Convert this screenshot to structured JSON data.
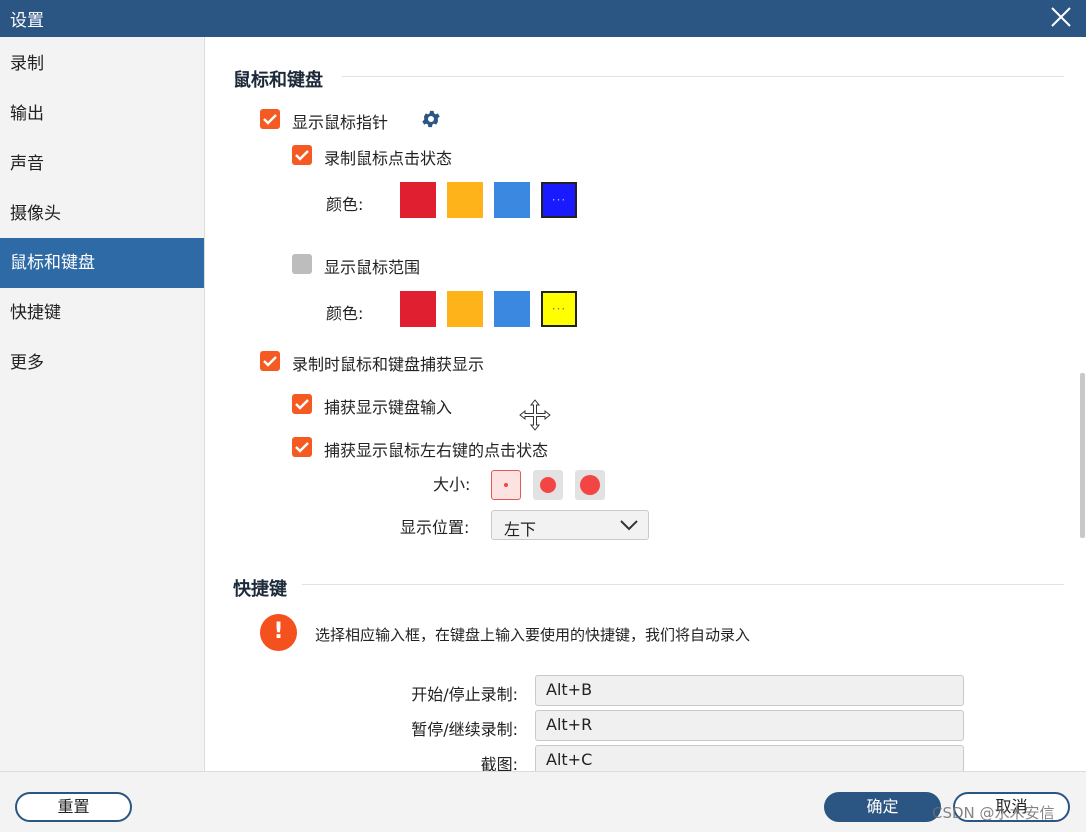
{
  "window": {
    "title": "设置"
  },
  "sidebar": {
    "items": [
      {
        "label": "录制"
      },
      {
        "label": "输出"
      },
      {
        "label": "声音"
      },
      {
        "label": "摄像头"
      },
      {
        "label": "鼠标和键盘",
        "active": true
      },
      {
        "label": "快捷键"
      },
      {
        "label": "更多"
      }
    ]
  },
  "mouse_section": {
    "title": "鼠标和键盘",
    "show_pointer": {
      "label": "显示鼠标指针",
      "checked": true
    },
    "record_click": {
      "label": "录制鼠标点击状态",
      "checked": true
    },
    "click_color": {
      "label": "颜色:",
      "swatches": [
        {
          "color": "#e02030"
        },
        {
          "color": "#ffb31a"
        },
        {
          "color": "#3a88e0"
        },
        {
          "color": "#1a1aff",
          "dots": "···",
          "selected": true
        }
      ]
    },
    "show_range": {
      "label": "显示鼠标范围",
      "checked": false
    },
    "range_color": {
      "label": "颜色:",
      "swatches": [
        {
          "color": "#e02030"
        },
        {
          "color": "#ffb31a"
        },
        {
          "color": "#3a88e0"
        },
        {
          "color": "#ffff00",
          "dots": "···",
          "selected": true
        }
      ]
    },
    "capture_display": {
      "label": "录制时鼠标和键盘捕获显示",
      "checked": true
    },
    "capture_keyboard": {
      "label": "捕获显示键盘输入",
      "checked": true
    },
    "capture_mouse_buttons": {
      "label": "捕获显示鼠标左右键的点击状态",
      "checked": true
    },
    "size": {
      "label": "大小:",
      "selected": "small"
    },
    "position": {
      "label": "显示位置:",
      "value": "左下"
    }
  },
  "hotkey_section": {
    "title": "快捷键",
    "hint": "选择相应输入框，在键盘上输入要使用的快捷键，我们将自动录入",
    "rows": [
      {
        "label": "开始/停止录制:",
        "value": "Alt+B"
      },
      {
        "label": "暂停/继续录制:",
        "value": "Alt+R"
      },
      {
        "label": "截图:",
        "value": "Alt+C"
      }
    ]
  },
  "footer": {
    "reset_label": "重置",
    "ok_label": "确定",
    "cancel_label": "取消",
    "watermark": "CSDN @水木安信"
  },
  "colors": {
    "titlebar": "#2b5582",
    "accent": "#f45a21",
    "active_sidebar": "#2e6aa5"
  }
}
